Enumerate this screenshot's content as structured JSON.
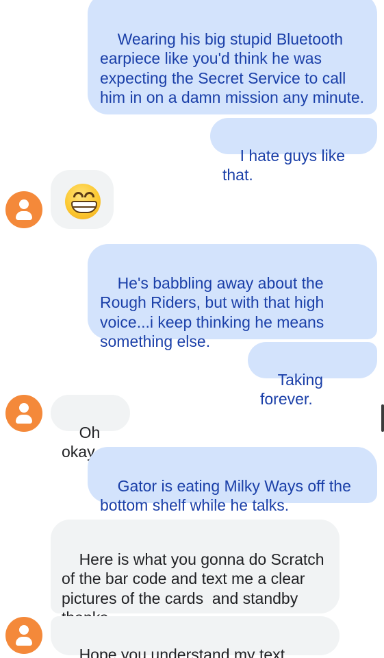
{
  "messages": [
    {
      "direction": "outgoing",
      "text": "Wearing his big stupid Bluetooth earpiece like you'd think he was expecting the Secret Service to call him in on a damn mission any minute."
    },
    {
      "direction": "outgoing",
      "text": "I hate guys like that."
    },
    {
      "direction": "incoming",
      "type": "emoji",
      "emoji": "grinning-face-with-smiling-eyes"
    },
    {
      "direction": "outgoing",
      "text": "He's babbling away about the Rough Riders, but with that high voice...i keep thinking he means something else."
    },
    {
      "direction": "outgoing",
      "text": "Taking forever."
    },
    {
      "direction": "incoming",
      "text": "Oh okay"
    },
    {
      "direction": "outgoing",
      "text": "Gator is eating Milky Ways off the bottom shelf while he talks."
    },
    {
      "direction": "incoming",
      "text": "Here is what you gonna do Scratch of the bar code and text me a clear pictures of the cards  and standby thanks"
    },
    {
      "direction": "incoming",
      "text": "Hope you understand my text thanks"
    }
  ],
  "colors": {
    "outgoing_bubble": "#d3e3fc",
    "outgoing_text": "#1a3fa8",
    "incoming_bubble": "#f1f3f4",
    "incoming_text": "#202124",
    "avatar": "#f4893a"
  }
}
